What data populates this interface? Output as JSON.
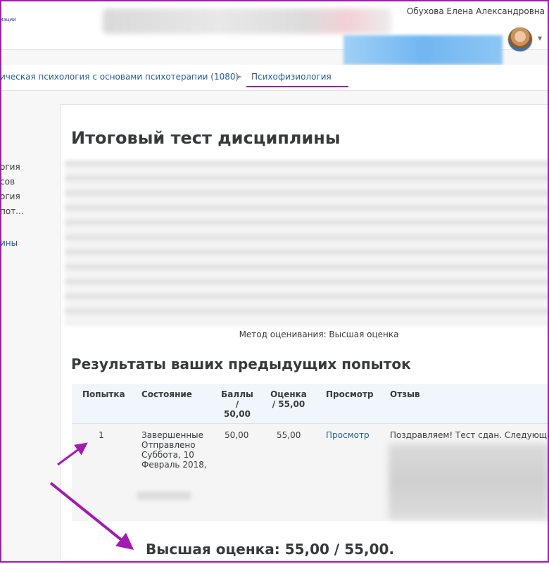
{
  "header": {
    "logo_text": "иации",
    "user_name": "Обухова Елена Александровна"
  },
  "breadcrumb": {
    "course": "ическая психология с основами психотерапии (1080)",
    "separator": "►",
    "current": "Психофизиология"
  },
  "left_nav": {
    "items": [
      "огия",
      "сов",
      "огия",
      "пот..."
    ],
    "active": "ины"
  },
  "quiz": {
    "title": "Итоговый тест дисциплины",
    "grading_method": "Метод оценивания: Высшая оценка",
    "results_title": "Результаты ваших предыдущих попыток",
    "best_grade": "Высшая оценка: 55,00 / 55,00."
  },
  "table": {
    "headers": {
      "attempt": "Попытка",
      "state": "Состояние",
      "marks_l1": "Баллы",
      "marks_l2": "/",
      "marks_l3": "50,00",
      "grade_l1": "Оценка",
      "grade_l2": "/ 55,00",
      "review": "Просмотр",
      "feedback": "Отзыв"
    },
    "row": {
      "attempt": "1",
      "state_l1": "Завершенные",
      "state_l2": "Отправлено",
      "state_l3": "Суббота, 10",
      "state_l4": "Февраль 2018,",
      "marks": "50,00",
      "grade": "55,00",
      "review": "Просмотр",
      "feedback": "Поздравляем! Тест сдан. Следующая"
    }
  },
  "colors": {
    "annotation": "#a21bb0",
    "link": "#1d5d96",
    "table_header_bg": "#f0f6fb"
  }
}
